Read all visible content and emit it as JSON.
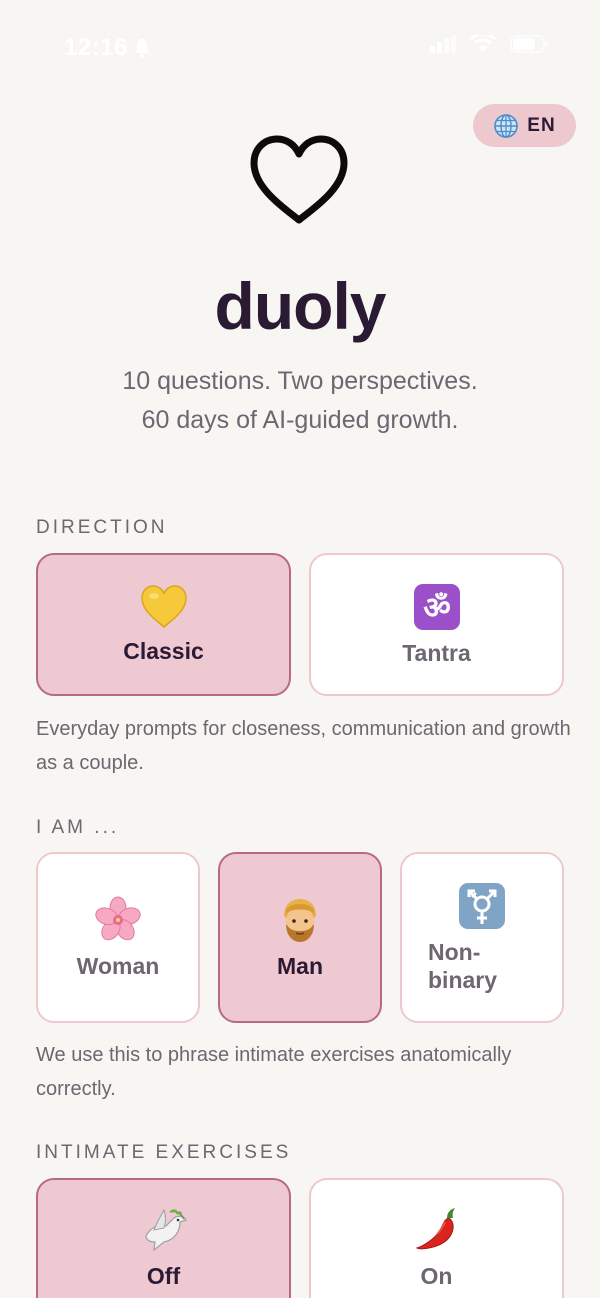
{
  "status_bar": {
    "time": "12:16"
  },
  "language": {
    "code": "EN",
    "icon": "globe-icon"
  },
  "brand": {
    "name": "duoly",
    "logo_icon": "heart-outline-icon"
  },
  "tagline": {
    "line1": "10 questions. Two perspectives.",
    "line2": "60 days of AI-guided growth."
  },
  "direction": {
    "label": "DIRECTION",
    "options": [
      {
        "label": "Classic",
        "icon": "yellow-heart-icon",
        "selected": true
      },
      {
        "label": "Tantra",
        "icon": "om-symbol-icon",
        "selected": false
      }
    ],
    "description": "Everyday prompts for closeness, communication and growth as a couple."
  },
  "identity": {
    "label": "I AM ...",
    "options": [
      {
        "label": "Woman",
        "icon": "cherry-blossom-icon",
        "selected": false
      },
      {
        "label": "Man",
        "icon": "man-icon",
        "selected": true
      },
      {
        "label": "Non-binary",
        "icon": "transgender-symbol-icon",
        "selected": false
      }
    ],
    "description": "We use this to phrase intimate exercises anatomically correctly."
  },
  "intimate": {
    "label": "INTIMATE EXERCISES",
    "options": [
      {
        "label": "Off",
        "icon": "dove-icon",
        "selected": true
      },
      {
        "label": "On",
        "icon": "chili-pepper-icon",
        "selected": false
      }
    ]
  },
  "colors": {
    "background": "#f8f6f3",
    "accent": "#efc9d1",
    "accent_border": "#b86a7f",
    "text": "#2b1a33"
  }
}
